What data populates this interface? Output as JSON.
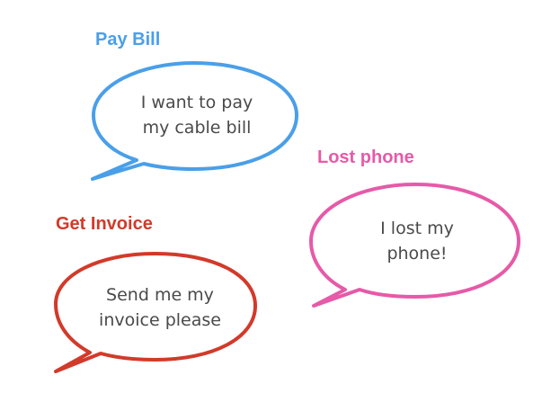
{
  "colors": {
    "pay_bill": "#4a9fe8",
    "lost_phone": "#e65aa8",
    "get_invoice": "#d23a2a",
    "body_text": "#4a4a4a",
    "background": "#ffffff"
  },
  "intents": [
    {
      "label": "Pay Bill",
      "utterance_line1": "I want to pay",
      "utterance_line2": "my cable bill"
    },
    {
      "label": "Lost phone",
      "utterance_line1": "I lost my",
      "utterance_line2": "phone!"
    },
    {
      "label": "Get Invoice",
      "utterance_line1": "Send me my",
      "utterance_line2": "invoice please"
    }
  ]
}
